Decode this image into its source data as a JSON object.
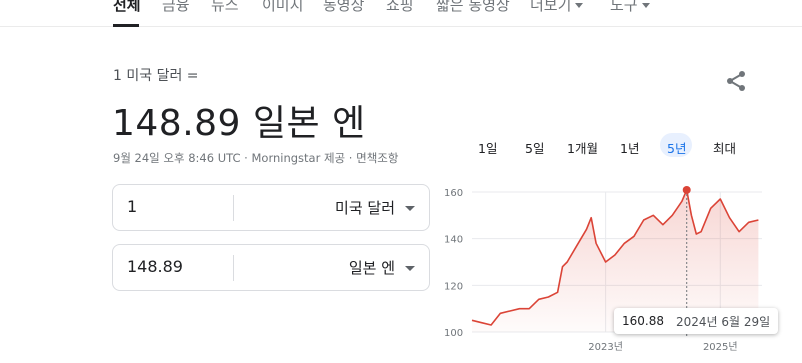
{
  "nav": {
    "items": [
      {
        "label": "전체",
        "active": true
      },
      {
        "label": "금융"
      },
      {
        "label": "뉴스"
      },
      {
        "label": "이미지"
      },
      {
        "label": "동영상"
      },
      {
        "label": "쇼핑"
      },
      {
        "label": "짧은 동영상"
      },
      {
        "label": "더보기",
        "dropdown": true
      },
      {
        "label": "도구",
        "dropdown": true
      }
    ]
  },
  "converter": {
    "from_line": "1 미국 달러 =",
    "result": "148.89 일본 엔",
    "meta": {
      "timestamp": "9월 24일 오후 8:46 UTC",
      "separator": "·",
      "provider": "Morningstar 제공",
      "disclaimer": "면책조항"
    },
    "from": {
      "value": "1",
      "unit": "미국 달러"
    },
    "to": {
      "value": "148.89",
      "unit": "일본 엔"
    }
  },
  "ranges": [
    "1일",
    "5일",
    "1개월",
    "1년",
    "5년",
    "최대"
  ],
  "selected_range": "5년",
  "colors": {
    "line": "#db4437",
    "fill": "#fce8e6",
    "selected": "#1a73e8"
  },
  "chart_data": {
    "type": "area",
    "y_ticks": [
      "160",
      "140",
      "120",
      "100"
    ],
    "x_ticks": [
      "2023년",
      "2025년"
    ],
    "ylim": [
      100,
      160
    ],
    "grid": true,
    "tooltip": {
      "value": "160.88",
      "date": "2024년 6월 29일"
    },
    "series": [
      {
        "x": [
          "2020-09",
          "2020-11",
          "2021-01",
          "2021-03",
          "2021-05",
          "2021-07",
          "2021-09",
          "2021-11",
          "2022-01",
          "2022-03",
          "2022-04",
          "2022-05",
          "2022-07",
          "2022-09",
          "2022-10",
          "2022-11",
          "2023-01",
          "2023-03",
          "2023-05",
          "2023-07",
          "2023-09",
          "2023-11",
          "2024-01",
          "2024-03",
          "2024-05",
          "2024-06",
          "2024-07",
          "2024-08",
          "2024-09",
          "2024-11",
          "2025-01",
          "2025-03",
          "2025-05",
          "2025-07",
          "2025-09"
        ],
        "values": [
          105,
          104,
          103,
          108,
          109,
          110,
          110,
          114,
          115,
          117,
          128,
          130,
          137,
          144,
          149,
          138,
          130,
          133,
          138,
          141,
          148,
          150,
          146,
          150,
          156,
          160.88,
          150,
          142,
          143,
          153,
          157,
          149,
          143,
          147,
          148
        ]
      }
    ]
  }
}
